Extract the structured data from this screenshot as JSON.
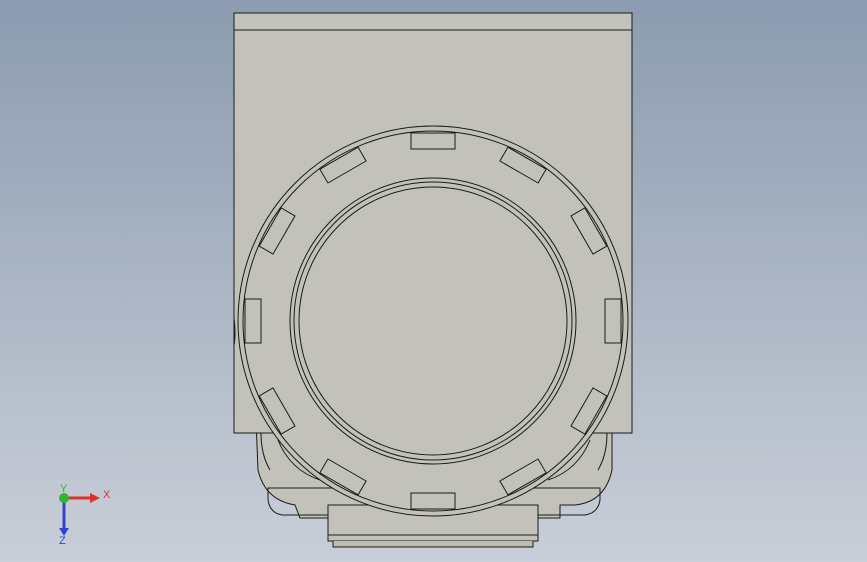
{
  "viewport": {
    "background_top_color": "#8c9bb0",
    "background_bottom_color": "#c9cfd8",
    "part_face_color": "#c3c2ba",
    "part_edge_color": "#1a1a1a"
  },
  "triad": {
    "x_label": "X",
    "y_label": "Y",
    "z_label": "Z",
    "x_color": "#e0302a",
    "y_color": "#2fb52f",
    "z_color": "#3344cc"
  }
}
